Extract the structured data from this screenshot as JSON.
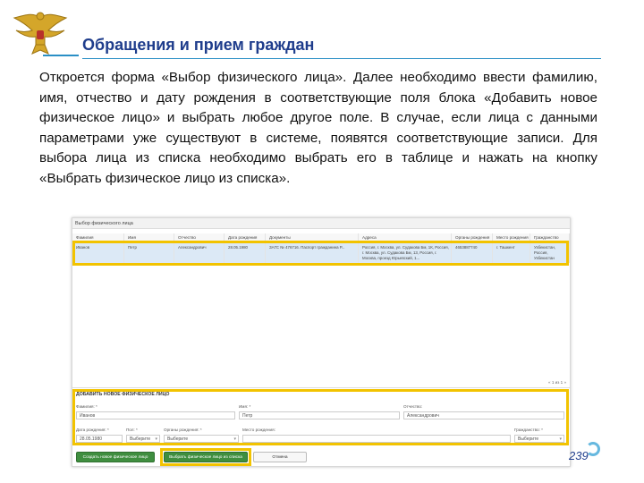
{
  "slide": {
    "title": "Обращения и прием граждан",
    "body": "Откроется форма «Выбор физического лица». Далее необходимо ввести фамилию, имя, отчество и дату рождения в соответствующие поля блока «Добавить новое физическое лицо» и выбрать любое другое поле. В случае, если лица с данными параметрами уже существуют в системе, появятся соответствующие записи. Для выбора лица из списка необходимо выбрать его в таблице и нажать на кнопку «Выбрать физическое лицо из списка».",
    "page_number": "239",
    "emblem_icon": "double-headed-eagle-emblem-icon"
  },
  "screenshot": {
    "window_title": "Выбор физического лица",
    "columns": [
      "Фамилия",
      "Имя",
      "Отчество",
      "Дата рождения",
      "Документы",
      "Адреса",
      "Органы рождения",
      "Место рождения",
      "Гражданство"
    ],
    "rows": [
      [
        "Иванов",
        "Петр",
        "Александрович",
        "28.05.1980",
        "ЗАГС № 476716. Паспорт гражданина Р...",
        "Россия, г. Москва, ул. Судакова Бм, 1К, Россия, г. Москва, ул. Судакова Бм, 13, Россия, г. Москва, проезд Юрьевский, 1...",
        "4653887740",
        "г. Ташкент",
        "Узбекистан, Россия, Узбекистан"
      ]
    ],
    "pager": "« 1 из 1 »",
    "form": {
      "title": "ДОБАВИТЬ НОВОЕ ФИЗИЧЕСКОЕ ЛИЦО",
      "lastname_label": "Фамилия: *",
      "lastname_value": "Иванов",
      "firstname_label": "Имя: *",
      "firstname_value": "Петр",
      "middlename_label": "Отчество:",
      "middlename_value": "Александрович",
      "birthdate_label": "Дата рождения: *",
      "birthdate_value": "28.05.1980",
      "gender_label": "Пол: *",
      "gender_value": "Выберите",
      "birth_authority_label": "Органы рождения: *",
      "birth_authority_value": "Выберите",
      "birthplace_label": "Место рождения:",
      "birthplace_value": "",
      "citizenship_label": "Гражданство: *",
      "citizenship_value": "Выберите"
    },
    "buttons": {
      "create": "Создать новое физическое лицо",
      "select": "Выбрать физическое лицо из списка",
      "cancel": "Отмена"
    },
    "colors": {
      "highlight": "#f2c300",
      "selected_row": "#dce9f6",
      "button_green": "#3f8e3f"
    }
  }
}
